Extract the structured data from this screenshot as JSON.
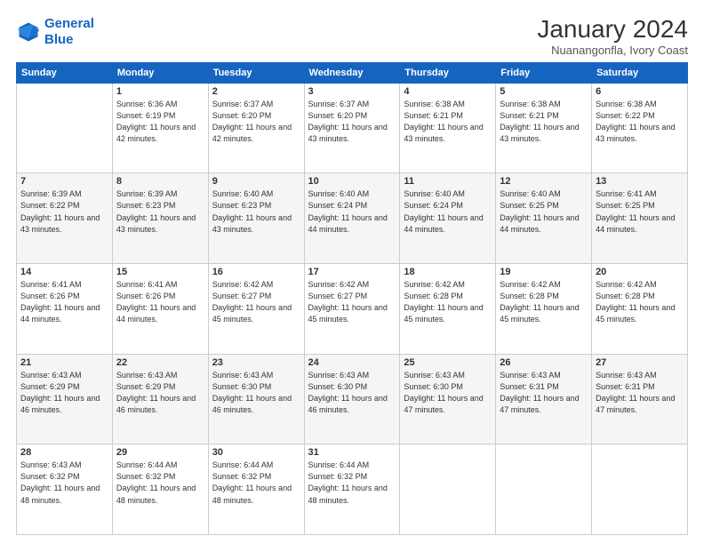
{
  "logo": {
    "line1": "General",
    "line2": "Blue"
  },
  "header": {
    "title": "January 2024",
    "subtitle": "Nuanangonfla, Ivory Coast"
  },
  "days_of_week": [
    "Sunday",
    "Monday",
    "Tuesday",
    "Wednesday",
    "Thursday",
    "Friday",
    "Saturday"
  ],
  "weeks": [
    [
      {
        "day": "",
        "sunrise": "",
        "sunset": "",
        "daylight": ""
      },
      {
        "day": "1",
        "sunrise": "Sunrise: 6:36 AM",
        "sunset": "Sunset: 6:19 PM",
        "daylight": "Daylight: 11 hours and 42 minutes."
      },
      {
        "day": "2",
        "sunrise": "Sunrise: 6:37 AM",
        "sunset": "Sunset: 6:20 PM",
        "daylight": "Daylight: 11 hours and 42 minutes."
      },
      {
        "day": "3",
        "sunrise": "Sunrise: 6:37 AM",
        "sunset": "Sunset: 6:20 PM",
        "daylight": "Daylight: 11 hours and 43 minutes."
      },
      {
        "day": "4",
        "sunrise": "Sunrise: 6:38 AM",
        "sunset": "Sunset: 6:21 PM",
        "daylight": "Daylight: 11 hours and 43 minutes."
      },
      {
        "day": "5",
        "sunrise": "Sunrise: 6:38 AM",
        "sunset": "Sunset: 6:21 PM",
        "daylight": "Daylight: 11 hours and 43 minutes."
      },
      {
        "day": "6",
        "sunrise": "Sunrise: 6:38 AM",
        "sunset": "Sunset: 6:22 PM",
        "daylight": "Daylight: 11 hours and 43 minutes."
      }
    ],
    [
      {
        "day": "7",
        "sunrise": "Sunrise: 6:39 AM",
        "sunset": "Sunset: 6:22 PM",
        "daylight": "Daylight: 11 hours and 43 minutes."
      },
      {
        "day": "8",
        "sunrise": "Sunrise: 6:39 AM",
        "sunset": "Sunset: 6:23 PM",
        "daylight": "Daylight: 11 hours and 43 minutes."
      },
      {
        "day": "9",
        "sunrise": "Sunrise: 6:40 AM",
        "sunset": "Sunset: 6:23 PM",
        "daylight": "Daylight: 11 hours and 43 minutes."
      },
      {
        "day": "10",
        "sunrise": "Sunrise: 6:40 AM",
        "sunset": "Sunset: 6:24 PM",
        "daylight": "Daylight: 11 hours and 44 minutes."
      },
      {
        "day": "11",
        "sunrise": "Sunrise: 6:40 AM",
        "sunset": "Sunset: 6:24 PM",
        "daylight": "Daylight: 11 hours and 44 minutes."
      },
      {
        "day": "12",
        "sunrise": "Sunrise: 6:40 AM",
        "sunset": "Sunset: 6:25 PM",
        "daylight": "Daylight: 11 hours and 44 minutes."
      },
      {
        "day": "13",
        "sunrise": "Sunrise: 6:41 AM",
        "sunset": "Sunset: 6:25 PM",
        "daylight": "Daylight: 11 hours and 44 minutes."
      }
    ],
    [
      {
        "day": "14",
        "sunrise": "Sunrise: 6:41 AM",
        "sunset": "Sunset: 6:26 PM",
        "daylight": "Daylight: 11 hours and 44 minutes."
      },
      {
        "day": "15",
        "sunrise": "Sunrise: 6:41 AM",
        "sunset": "Sunset: 6:26 PM",
        "daylight": "Daylight: 11 hours and 44 minutes."
      },
      {
        "day": "16",
        "sunrise": "Sunrise: 6:42 AM",
        "sunset": "Sunset: 6:27 PM",
        "daylight": "Daylight: 11 hours and 45 minutes."
      },
      {
        "day": "17",
        "sunrise": "Sunrise: 6:42 AM",
        "sunset": "Sunset: 6:27 PM",
        "daylight": "Daylight: 11 hours and 45 minutes."
      },
      {
        "day": "18",
        "sunrise": "Sunrise: 6:42 AM",
        "sunset": "Sunset: 6:28 PM",
        "daylight": "Daylight: 11 hours and 45 minutes."
      },
      {
        "day": "19",
        "sunrise": "Sunrise: 6:42 AM",
        "sunset": "Sunset: 6:28 PM",
        "daylight": "Daylight: 11 hours and 45 minutes."
      },
      {
        "day": "20",
        "sunrise": "Sunrise: 6:42 AM",
        "sunset": "Sunset: 6:28 PM",
        "daylight": "Daylight: 11 hours and 45 minutes."
      }
    ],
    [
      {
        "day": "21",
        "sunrise": "Sunrise: 6:43 AM",
        "sunset": "Sunset: 6:29 PM",
        "daylight": "Daylight: 11 hours and 46 minutes."
      },
      {
        "day": "22",
        "sunrise": "Sunrise: 6:43 AM",
        "sunset": "Sunset: 6:29 PM",
        "daylight": "Daylight: 11 hours and 46 minutes."
      },
      {
        "day": "23",
        "sunrise": "Sunrise: 6:43 AM",
        "sunset": "Sunset: 6:30 PM",
        "daylight": "Daylight: 11 hours and 46 minutes."
      },
      {
        "day": "24",
        "sunrise": "Sunrise: 6:43 AM",
        "sunset": "Sunset: 6:30 PM",
        "daylight": "Daylight: 11 hours and 46 minutes."
      },
      {
        "day": "25",
        "sunrise": "Sunrise: 6:43 AM",
        "sunset": "Sunset: 6:30 PM",
        "daylight": "Daylight: 11 hours and 47 minutes."
      },
      {
        "day": "26",
        "sunrise": "Sunrise: 6:43 AM",
        "sunset": "Sunset: 6:31 PM",
        "daylight": "Daylight: 11 hours and 47 minutes."
      },
      {
        "day": "27",
        "sunrise": "Sunrise: 6:43 AM",
        "sunset": "Sunset: 6:31 PM",
        "daylight": "Daylight: 11 hours and 47 minutes."
      }
    ],
    [
      {
        "day": "28",
        "sunrise": "Sunrise: 6:43 AM",
        "sunset": "Sunset: 6:32 PM",
        "daylight": "Daylight: 11 hours and 48 minutes."
      },
      {
        "day": "29",
        "sunrise": "Sunrise: 6:44 AM",
        "sunset": "Sunset: 6:32 PM",
        "daylight": "Daylight: 11 hours and 48 minutes."
      },
      {
        "day": "30",
        "sunrise": "Sunrise: 6:44 AM",
        "sunset": "Sunset: 6:32 PM",
        "daylight": "Daylight: 11 hours and 48 minutes."
      },
      {
        "day": "31",
        "sunrise": "Sunrise: 6:44 AM",
        "sunset": "Sunset: 6:32 PM",
        "daylight": "Daylight: 11 hours and 48 minutes."
      },
      {
        "day": "",
        "sunrise": "",
        "sunset": "",
        "daylight": ""
      },
      {
        "day": "",
        "sunrise": "",
        "sunset": "",
        "daylight": ""
      },
      {
        "day": "",
        "sunrise": "",
        "sunset": "",
        "daylight": ""
      }
    ]
  ]
}
